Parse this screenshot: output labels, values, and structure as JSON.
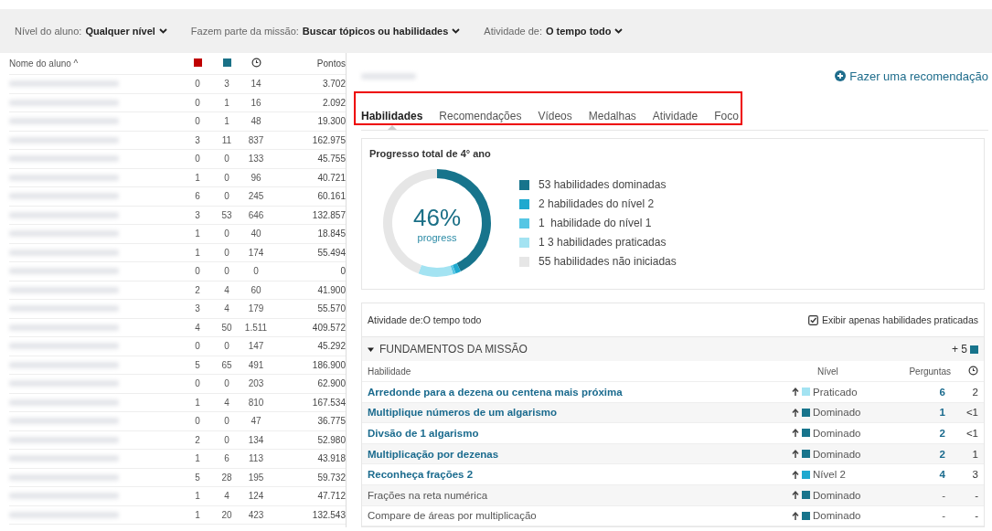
{
  "filters": [
    {
      "label": "Nível do aluno:",
      "value": "Qualquer nível"
    },
    {
      "label": "Fazem parte da missão:",
      "value": "Buscar tópicos ou habilidades"
    },
    {
      "label": "Atividade de:",
      "value": "O tempo todo"
    }
  ],
  "students": {
    "columns": [
      {
        "kind": "text",
        "label": "Nome do aluno ^"
      },
      {
        "kind": "square",
        "color": "#c00000"
      },
      {
        "kind": "square",
        "color": "#1a7187"
      },
      {
        "kind": "clock"
      },
      {
        "kind": "text",
        "label": "Pontos"
      }
    ],
    "rows": [
      {
        "values": [
          "0",
          "3",
          "14",
          "3.702"
        ]
      },
      {
        "values": [
          "0",
          "1",
          "16",
          "2.092"
        ]
      },
      {
        "values": [
          "0",
          "1",
          "48",
          "19.300"
        ]
      },
      {
        "values": [
          "3",
          "11",
          "837",
          "162.975"
        ]
      },
      {
        "values": [
          "0",
          "0",
          "133",
          "45.755"
        ]
      },
      {
        "values": [
          "1",
          "0",
          "96",
          "40.721"
        ]
      },
      {
        "values": [
          "6",
          "0",
          "245",
          "60.161"
        ]
      },
      {
        "values": [
          "3",
          "53",
          "646",
          "132.857"
        ]
      },
      {
        "values": [
          "1",
          "0",
          "40",
          "18.845"
        ]
      },
      {
        "values": [
          "1",
          "0",
          "174",
          "55.494"
        ]
      },
      {
        "values": [
          "0",
          "0",
          "0",
          "0"
        ]
      },
      {
        "values": [
          "2",
          "4",
          "60",
          "41.900"
        ]
      },
      {
        "values": [
          "3",
          "4",
          "179",
          "55.570"
        ]
      },
      {
        "values": [
          "4",
          "50",
          "1.511",
          "409.572"
        ]
      },
      {
        "values": [
          "0",
          "0",
          "147",
          "45.292"
        ]
      },
      {
        "values": [
          "5",
          "65",
          "491",
          "186.900"
        ]
      },
      {
        "values": [
          "0",
          "0",
          "203",
          "62.900"
        ]
      },
      {
        "values": [
          "1",
          "4",
          "810",
          "167.534"
        ]
      },
      {
        "values": [
          "0",
          "0",
          "47",
          "36.775"
        ]
      },
      {
        "values": [
          "2",
          "0",
          "134",
          "52.980"
        ]
      },
      {
        "values": [
          "1",
          "6",
          "113",
          "43.918"
        ]
      },
      {
        "values": [
          "5",
          "28",
          "195",
          "59.732"
        ]
      },
      {
        "values": [
          "1",
          "4",
          "124",
          "47.712"
        ]
      },
      {
        "values": [
          "1",
          "20",
          "423",
          "132.543"
        ]
      }
    ]
  },
  "detail": {
    "recommend_link": "Fazer uma recomendação",
    "tabs": [
      {
        "label": "Habilidades",
        "selected": true
      },
      {
        "label": "Recomendações",
        "selected": false
      },
      {
        "label": "Vídeos",
        "selected": false
      },
      {
        "label": "Medalhas",
        "selected": false
      },
      {
        "label": "Atividade",
        "selected": false
      },
      {
        "label": "Foco",
        "selected": false
      }
    ],
    "progress": {
      "title": "Progresso total de 4° ano",
      "percent": "46%",
      "caption": "progress",
      "chart_data": {
        "type": "donut",
        "categories": [
          "53 habilidades dominadas",
          "2 habilidades do nível 2",
          "1  habilidade do nível 1",
          "1 3 habilidades praticadas",
          "55 habilidades não iniciadas"
        ],
        "values": [
          53,
          2,
          1,
          13,
          55
        ],
        "colors": [
          "#17748c",
          "#1fa9cf",
          "#55c6e4",
          "#a3e3f2",
          "#e6e6e6"
        ]
      }
    },
    "activity": {
      "label": "Atividade de:O tempo todo",
      "checkbox": {
        "label": "Exibir apenas habilidades praticadas",
        "checked": true
      },
      "group": {
        "title": "FUNDAMENTOS DA MISSÃO",
        "expanded": true,
        "gain": "+ 5",
        "columns": [
          "Habilidade",
          "Nível",
          "Perguntas"
        ],
        "skills": [
          {
            "name": "Arredonde para a dezena ou centena mais próxima",
            "kind": "link",
            "level": "Praticado",
            "color": "#a3e3f2",
            "questions": "6",
            "time": "2"
          },
          {
            "name": "Multiplique números de um algarismo",
            "kind": "link",
            "level": "Dominado",
            "color": "#17748c",
            "questions": "1",
            "time": "<1"
          },
          {
            "name": "Divsão de 1 algarismo",
            "kind": "link",
            "level": "Dominado",
            "color": "#17748c",
            "questions": "2",
            "time": "<1"
          },
          {
            "name": "Multiplicação por dezenas",
            "kind": "link",
            "level": "Dominado",
            "color": "#17748c",
            "questions": "2",
            "time": "1"
          },
          {
            "name": "Reconheça frações 2",
            "kind": "link",
            "level": "Nível 2",
            "color": "#1fa9cf",
            "questions": "4",
            "time": "3"
          },
          {
            "name": "Frações na reta numérica",
            "kind": "plain",
            "level": "Dominado",
            "color": "#17748c",
            "questions": "-",
            "time": "-"
          },
          {
            "name": "Compare de áreas por multiplicação",
            "kind": "plain",
            "level": "Dominado",
            "color": "#17748c",
            "questions": "-",
            "time": "-"
          }
        ]
      }
    }
  }
}
